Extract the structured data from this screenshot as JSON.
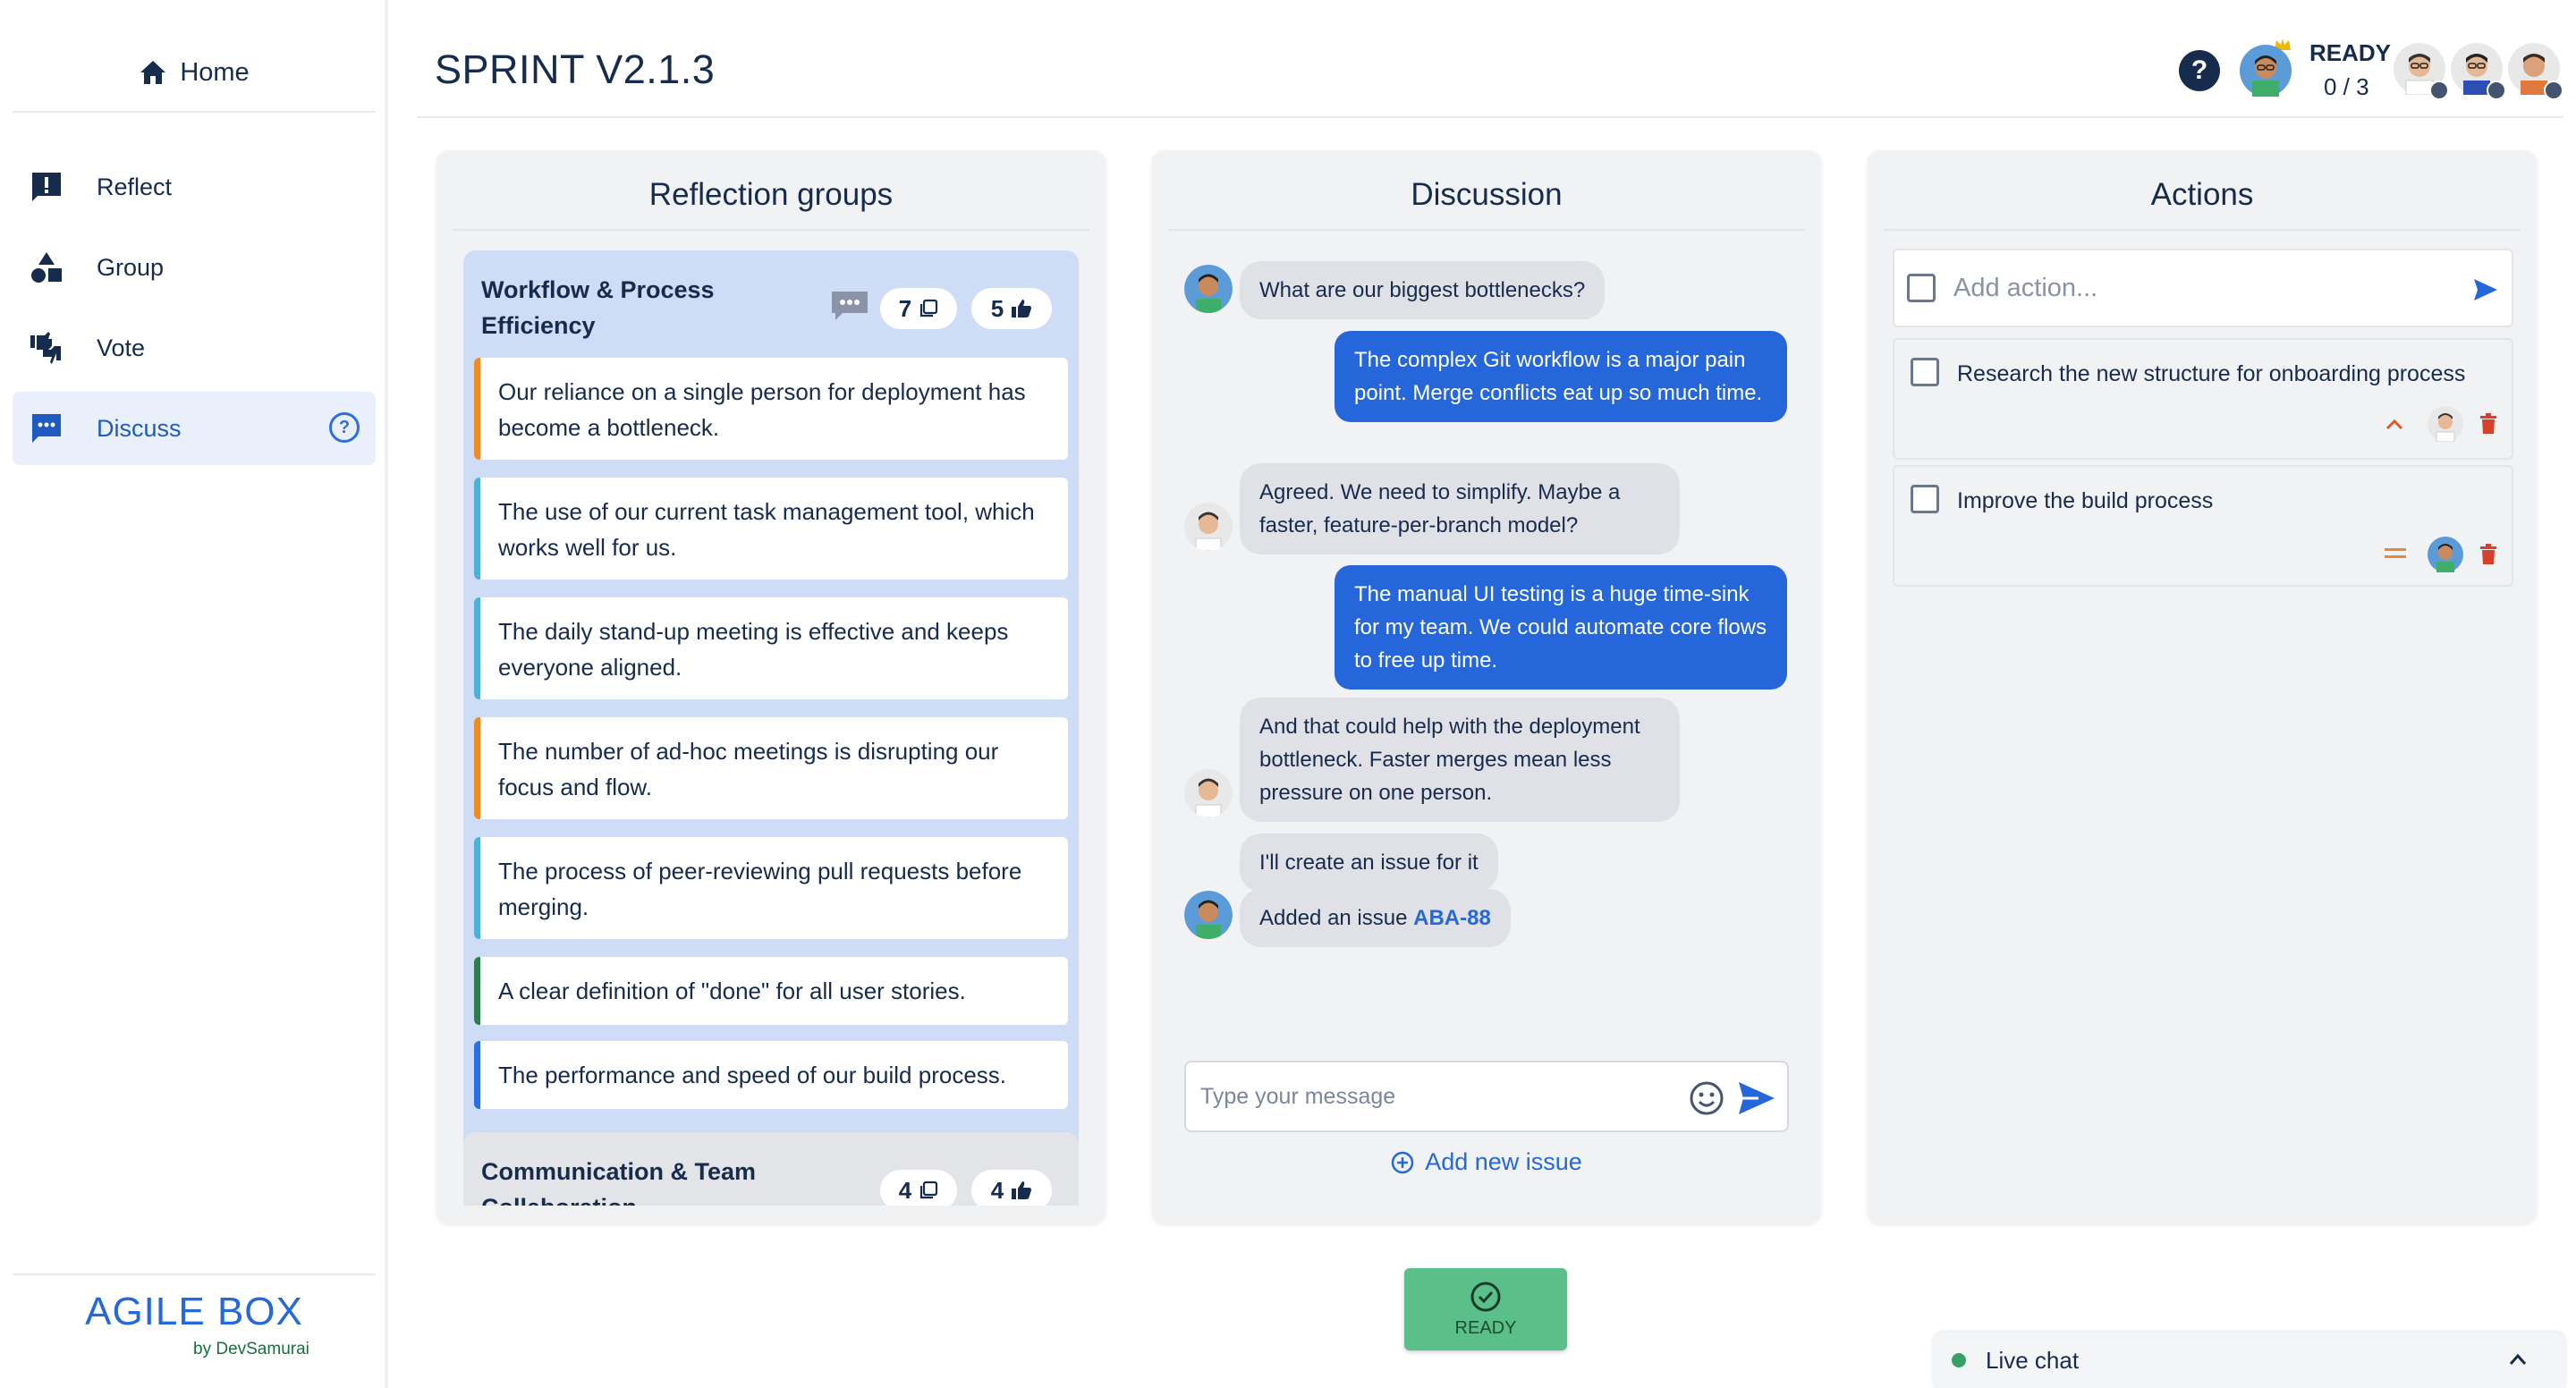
{
  "sidebar": {
    "home_label": "Home",
    "items": [
      {
        "label": "Reflect",
        "icon": "reflect-icon"
      },
      {
        "label": "Group",
        "icon": "group-shapes-icon"
      },
      {
        "label": "Vote",
        "icon": "vote-thumbs-icon"
      },
      {
        "label": "Discuss",
        "icon": "discuss-icon"
      }
    ],
    "active_item": "Discuss",
    "help_symbol": "?",
    "brand_name": "AGILE BOX",
    "brand_sub": "by DevSamurai"
  },
  "header": {
    "title": "SPRINT V2.1.3",
    "help_symbol": "?",
    "ready_label": "READY",
    "ready_count": "0 / 3"
  },
  "reflection": {
    "title": "Reflection groups",
    "groups": [
      {
        "title": "Workflow & Process Efficiency",
        "cards_count": "7",
        "votes_count": "5",
        "cards": [
          {
            "text": "Our reliance on a single person for deployment has become a bottleneck.",
            "color": "#f08a24"
          },
          {
            "text": "The use of our current task management tool, which works well for us.",
            "color": "#4fb0d8"
          },
          {
            "text": "The daily stand-up meeting is effective and keeps everyone aligned.",
            "color": "#4fb0d8"
          },
          {
            "text": "The number of ad-hoc meetings is disrupting our focus and flow.",
            "color": "#f08a24"
          },
          {
            "text": "The process of peer-reviewing pull requests before merging.",
            "color": "#4fb0d8"
          },
          {
            "text": "A clear definition of \"done\" for all user stories.",
            "color": "#2e7d4f"
          },
          {
            "text": "The performance and speed of our build process.",
            "color": "#2d6fe0"
          }
        ]
      },
      {
        "title": "Communication & Team Collaboration",
        "cards_count": "4",
        "votes_count": "4"
      }
    ]
  },
  "discussion": {
    "title": "Discussion",
    "messages": [
      {
        "text": "What are our biggest bottlenecks?",
        "side": "in"
      },
      {
        "text": "The complex Git workflow is a major pain point. Merge conflicts eat up so much time.",
        "side": "out"
      },
      {
        "text": "Agreed. We need to simplify. Maybe a faster, feature-per-branch model?",
        "side": "in"
      },
      {
        "text": "The manual UI testing is a huge time-sink for my team. We could automate core flows to free up time.",
        "side": "out"
      },
      {
        "text": "And that could help with the deployment bottleneck. Faster merges mean less pressure on one person.",
        "side": "in"
      },
      {
        "text": "I'll create an issue for it",
        "side": "in"
      },
      {
        "text": "Added an issue",
        "issue_key": "ABA-88",
        "side": "in"
      }
    ],
    "input_placeholder": "Type your message",
    "add_issue_label": "Add new issue"
  },
  "actions": {
    "title": "Actions",
    "input_placeholder": "Add action...",
    "items": [
      {
        "text": "Research the new structure for onboarding process",
        "priority": "high",
        "checked": false
      },
      {
        "text": "Improve the build process",
        "priority": "medium",
        "checked": false
      }
    ]
  },
  "ready_button": {
    "label": "READY"
  },
  "live_chat": {
    "label": "Live chat"
  },
  "colors": {
    "accent": "#2666db",
    "ready_green": "#5bbf8a",
    "priority_high": "#e2572b",
    "priority_medium": "#e8873a",
    "delete_red": "#d6412c"
  }
}
